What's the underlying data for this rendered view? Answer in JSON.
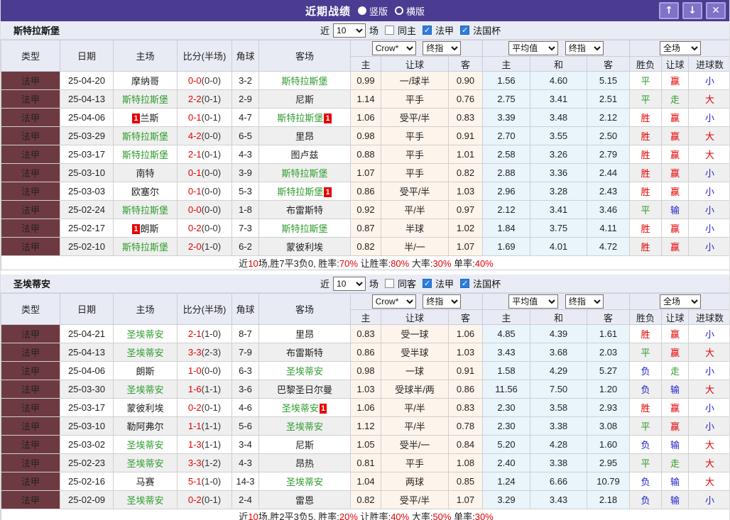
{
  "colors": {
    "accent": "#4b3c92",
    "maroon": "#6e3a41",
    "green": "#2e9b2e",
    "red": "#e60000",
    "blue": "#2323cc",
    "cream": "#fdf4ec",
    "light_blue": "#e9f4fb"
  },
  "result_colors": {
    "胜": "red",
    "平": "green",
    "负": "blue",
    "赢": "red",
    "走": "green",
    "输": "blue",
    "大": "red",
    "小": "blue"
  },
  "titlebar": {
    "title": "近期战绩",
    "radios": [
      {
        "label": "竖版",
        "selected": true
      },
      {
        "label": "横版",
        "selected": false
      }
    ],
    "buttons": {
      "up": "↑",
      "down": "↓",
      "close": "✕"
    }
  },
  "table_header": {
    "cols": [
      "类型",
      "日期",
      "主场",
      "比分(半场)",
      "角球",
      "客场"
    ],
    "odds_source": "Crow*",
    "odds_time": "终指",
    "avg_source": "平均值",
    "avg_time": "终指",
    "scope": "全场",
    "sub_cols": [
      "主",
      "让球",
      "客",
      "主",
      "和",
      "客",
      "胜负",
      "让球",
      "进球数"
    ]
  },
  "sections": [
    {
      "team": "斯特拉斯堡",
      "filters": {
        "prefix": "近",
        "count": "10",
        "suffix": "场",
        "same_label": "同主",
        "same_checked": false,
        "league_label": "法甲",
        "league_checked": true,
        "cup_label": "法国杯",
        "cup_checked": true
      },
      "rows": [
        {
          "league": "法甲",
          "date": "25-04-20",
          "home": "摩纳哥",
          "home_green": false,
          "home_badge": false,
          "score": "0-0",
          "half": "(0-0)",
          "corners": "3-2",
          "away": "斯特拉斯堡",
          "away_green": true,
          "away_badge": false,
          "odds": [
            "0.99",
            "一/球半",
            "0.90"
          ],
          "avg": [
            "1.56",
            "4.60",
            "5.15"
          ],
          "results": [
            "平",
            "赢",
            "小"
          ]
        },
        {
          "league": "法甲",
          "date": "25-04-13",
          "home": "斯特拉斯堡",
          "home_green": true,
          "home_badge": false,
          "score": "2-2",
          "half": "(0-1)",
          "corners": "2-9",
          "away": "尼斯",
          "away_green": false,
          "away_badge": false,
          "odds": [
            "1.14",
            "平手",
            "0.76"
          ],
          "avg": [
            "2.75",
            "3.41",
            "2.51"
          ],
          "results": [
            "平",
            "走",
            "大"
          ]
        },
        {
          "league": "法甲",
          "date": "25-04-06",
          "home": "兰斯",
          "home_green": false,
          "home_badge": true,
          "score": "0-1",
          "half": "(0-1)",
          "corners": "4-7",
          "away": "斯特拉斯堡",
          "away_green": true,
          "away_badge": true,
          "odds": [
            "1.06",
            "受平/半",
            "0.83"
          ],
          "avg": [
            "3.39",
            "3.48",
            "2.12"
          ],
          "results": [
            "胜",
            "赢",
            "小"
          ]
        },
        {
          "league": "法甲",
          "date": "25-03-29",
          "home": "斯特拉斯堡",
          "home_green": true,
          "home_badge": false,
          "score": "4-2",
          "half": "(0-0)",
          "corners": "6-5",
          "away": "里昂",
          "away_green": false,
          "away_badge": false,
          "odds": [
            "0.98",
            "平手",
            "0.91"
          ],
          "avg": [
            "2.70",
            "3.55",
            "2.50"
          ],
          "results": [
            "胜",
            "赢",
            "大"
          ]
        },
        {
          "league": "法甲",
          "date": "25-03-17",
          "home": "斯特拉斯堡",
          "home_green": true,
          "home_badge": false,
          "score": "2-1",
          "half": "(0-1)",
          "corners": "4-3",
          "away": "图卢兹",
          "away_green": false,
          "away_badge": false,
          "odds": [
            "0.88",
            "平手",
            "1.01"
          ],
          "avg": [
            "2.58",
            "3.26",
            "2.79"
          ],
          "results": [
            "胜",
            "赢",
            "大"
          ]
        },
        {
          "league": "法甲",
          "date": "25-03-10",
          "home": "南特",
          "home_green": false,
          "home_badge": false,
          "score": "0-1",
          "half": "(0-0)",
          "corners": "3-9",
          "away": "斯特拉斯堡",
          "away_green": true,
          "away_badge": false,
          "odds": [
            "1.07",
            "平手",
            "0.82"
          ],
          "avg": [
            "2.88",
            "3.36",
            "2.44"
          ],
          "results": [
            "胜",
            "赢",
            "小"
          ]
        },
        {
          "league": "法甲",
          "date": "25-03-03",
          "home": "欧塞尔",
          "home_green": false,
          "home_badge": false,
          "score": "0-1",
          "half": "(0-0)",
          "corners": "5-3",
          "away": "斯特拉斯堡",
          "away_green": true,
          "away_badge": true,
          "odds": [
            "0.86",
            "受平/半",
            "1.03"
          ],
          "avg": [
            "2.96",
            "3.28",
            "2.43"
          ],
          "results": [
            "胜",
            "赢",
            "小"
          ]
        },
        {
          "league": "法甲",
          "date": "25-02-24",
          "home": "斯特拉斯堡",
          "home_green": true,
          "home_badge": false,
          "score": "0-0",
          "half": "(0-0)",
          "corners": "1-8",
          "away": "布雷斯特",
          "away_green": false,
          "away_badge": false,
          "odds": [
            "0.92",
            "平/半",
            "0.97"
          ],
          "avg": [
            "2.12",
            "3.41",
            "3.46"
          ],
          "results": [
            "平",
            "输",
            "小"
          ]
        },
        {
          "league": "法甲",
          "date": "25-02-17",
          "home": "朗斯",
          "home_green": false,
          "home_badge": true,
          "score": "0-2",
          "half": "(0-0)",
          "corners": "7-3",
          "away": "斯特拉斯堡",
          "away_green": true,
          "away_badge": false,
          "odds": [
            "0.87",
            "半球",
            "1.02"
          ],
          "avg": [
            "1.84",
            "3.75",
            "4.11"
          ],
          "results": [
            "胜",
            "赢",
            "小"
          ]
        },
        {
          "league": "法甲",
          "date": "25-02-10",
          "home": "斯特拉斯堡",
          "home_green": true,
          "home_badge": false,
          "score": "2-0",
          "half": "(1-0)",
          "corners": "6-2",
          "away": "蒙彼利埃",
          "away_green": false,
          "away_badge": false,
          "odds": [
            "0.82",
            "半/一",
            "1.07"
          ],
          "avg": [
            "1.69",
            "4.01",
            "4.72"
          ],
          "results": [
            "胜",
            "赢",
            "小"
          ]
        }
      ],
      "summary": [
        {
          "t": "近"
        },
        {
          "t": "10",
          "red": true
        },
        {
          "t": "场,胜7平3负0, 胜率:"
        },
        {
          "t": "70%",
          "red": true
        },
        {
          "t": " 让胜率:"
        },
        {
          "t": "80%",
          "red": true
        },
        {
          "t": " 大率:"
        },
        {
          "t": "30%",
          "red": true
        },
        {
          "t": " 单率:"
        },
        {
          "t": "40%",
          "red": true
        }
      ]
    },
    {
      "team": "圣埃蒂安",
      "filters": {
        "prefix": "近",
        "count": "10",
        "suffix": "场",
        "same_label": "同客",
        "same_checked": false,
        "league_label": "法甲",
        "league_checked": true,
        "cup_label": "法国杯",
        "cup_checked": true
      },
      "rows": [
        {
          "league": "法甲",
          "date": "25-04-21",
          "home": "圣埃蒂安",
          "home_green": true,
          "home_badge": false,
          "score": "2-1",
          "half": "(1-0)",
          "corners": "8-7",
          "away": "里昂",
          "away_green": false,
          "away_badge": false,
          "odds": [
            "0.83",
            "受一球",
            "1.06"
          ],
          "avg": [
            "4.85",
            "4.39",
            "1.61"
          ],
          "results": [
            "胜",
            "赢",
            "小"
          ]
        },
        {
          "league": "法甲",
          "date": "25-04-13",
          "home": "圣埃蒂安",
          "home_green": true,
          "home_badge": false,
          "score": "3-3",
          "half": "(2-3)",
          "corners": "7-9",
          "away": "布雷斯特",
          "away_green": false,
          "away_badge": false,
          "odds": [
            "0.86",
            "受半球",
            "1.03"
          ],
          "avg": [
            "3.43",
            "3.68",
            "2.03"
          ],
          "results": [
            "平",
            "赢",
            "大"
          ]
        },
        {
          "league": "法甲",
          "date": "25-04-06",
          "home": "朗斯",
          "home_green": false,
          "home_badge": false,
          "score": "1-0",
          "half": "(0-0)",
          "corners": "6-3",
          "away": "圣埃蒂安",
          "away_green": true,
          "away_badge": false,
          "odds": [
            "0.98",
            "一球",
            "0.91"
          ],
          "avg": [
            "1.58",
            "4.29",
            "5.27"
          ],
          "results": [
            "负",
            "走",
            "小"
          ]
        },
        {
          "league": "法甲",
          "date": "25-03-30",
          "home": "圣埃蒂安",
          "home_green": true,
          "home_badge": false,
          "score": "1-6",
          "half": "(1-1)",
          "corners": "3-6",
          "away": "巴黎圣日尔曼",
          "away_green": false,
          "away_badge": false,
          "odds": [
            "1.03",
            "受球半/两",
            "0.86"
          ],
          "avg": [
            "11.56",
            "7.50",
            "1.20"
          ],
          "results": [
            "负",
            "输",
            "大"
          ]
        },
        {
          "league": "法甲",
          "date": "25-03-17",
          "home": "蒙彼利埃",
          "home_green": false,
          "home_badge": false,
          "score": "0-2",
          "half": "(0-1)",
          "corners": "4-6",
          "away": "圣埃蒂安",
          "away_green": true,
          "away_badge": true,
          "odds": [
            "1.06",
            "平/半",
            "0.83"
          ],
          "avg": [
            "2.30",
            "3.58",
            "2.93"
          ],
          "results": [
            "胜",
            "赢",
            "小"
          ]
        },
        {
          "league": "法甲",
          "date": "25-03-10",
          "home": "勒阿弗尔",
          "home_green": false,
          "home_badge": false,
          "score": "1-1",
          "half": "(1-1)",
          "corners": "5-6",
          "away": "圣埃蒂安",
          "away_green": true,
          "away_badge": false,
          "odds": [
            "1.12",
            "平/半",
            "0.78"
          ],
          "avg": [
            "2.30",
            "3.38",
            "3.08"
          ],
          "results": [
            "平",
            "赢",
            "小"
          ]
        },
        {
          "league": "法甲",
          "date": "25-03-02",
          "home": "圣埃蒂安",
          "home_green": true,
          "home_badge": false,
          "score": "1-3",
          "half": "(1-1)",
          "corners": "3-4",
          "away": "尼斯",
          "away_green": false,
          "away_badge": false,
          "odds": [
            "1.05",
            "受半/一",
            "0.84"
          ],
          "avg": [
            "5.20",
            "4.28",
            "1.60"
          ],
          "results": [
            "负",
            "输",
            "大"
          ]
        },
        {
          "league": "法甲",
          "date": "25-02-23",
          "home": "圣埃蒂安",
          "home_green": true,
          "home_badge": false,
          "score": "3-3",
          "half": "(1-2)",
          "corners": "4-3",
          "away": "昂热",
          "away_green": false,
          "away_badge": false,
          "odds": [
            "0.81",
            "平手",
            "1.08"
          ],
          "avg": [
            "2.40",
            "3.38",
            "2.95"
          ],
          "results": [
            "平",
            "走",
            "大"
          ]
        },
        {
          "league": "法甲",
          "date": "25-02-16",
          "home": "马赛",
          "home_green": false,
          "home_badge": false,
          "score": "5-1",
          "half": "(1-0)",
          "corners": "14-3",
          "away": "圣埃蒂安",
          "away_green": true,
          "away_badge": false,
          "odds": [
            "1.04",
            "两球",
            "0.85"
          ],
          "avg": [
            "1.24",
            "6.66",
            "10.79"
          ],
          "results": [
            "负",
            "输",
            "大"
          ]
        },
        {
          "league": "法甲",
          "date": "25-02-09",
          "home": "圣埃蒂安",
          "home_green": true,
          "home_badge": false,
          "score": "0-2",
          "half": "(0-1)",
          "corners": "2-4",
          "away": "雷恩",
          "away_green": false,
          "away_badge": false,
          "odds": [
            "0.82",
            "受平/半",
            "1.07"
          ],
          "avg": [
            "3.29",
            "3.43",
            "2.18"
          ],
          "results": [
            "负",
            "输",
            "小"
          ]
        }
      ],
      "summary": [
        {
          "t": "近"
        },
        {
          "t": "10",
          "red": true
        },
        {
          "t": "场,胜2平3负5, 胜率:"
        },
        {
          "t": "20%",
          "red": true
        },
        {
          "t": " 让胜率:"
        },
        {
          "t": "40%",
          "red": true
        },
        {
          "t": " 大率:"
        },
        {
          "t": "50%",
          "red": true
        },
        {
          "t": " 单率:"
        },
        {
          "t": "30%",
          "red": true
        }
      ]
    }
  ]
}
